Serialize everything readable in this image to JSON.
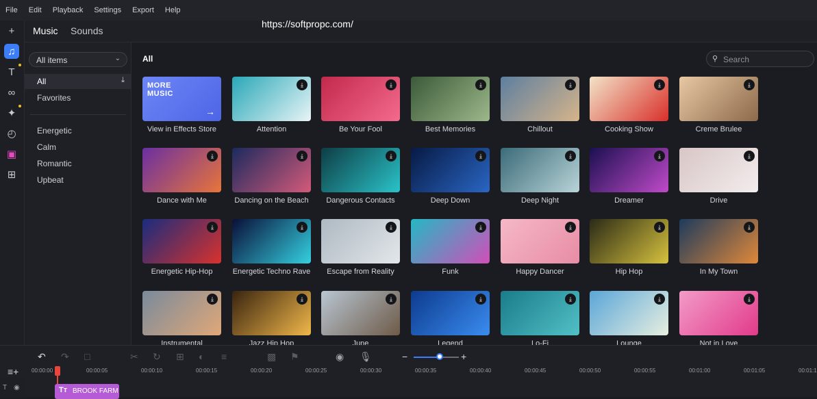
{
  "menu": [
    "File",
    "Edit",
    "Playback",
    "Settings",
    "Export",
    "Help"
  ],
  "watermark": "https://softpropc.com/",
  "tabs": {
    "music": "Music",
    "sounds": "Sounds"
  },
  "rail_icons": [
    "plus-icon",
    "music-note-icon",
    "text-icon",
    "transitions-icon",
    "magic-wand-icon",
    "stickers-icon",
    "shopping-bag-icon",
    "more-tools-icon"
  ],
  "sidebar": {
    "dropdown_value": "All items",
    "items": [
      {
        "label": "All",
        "active": true
      },
      {
        "label": "Favorites",
        "active": false
      },
      {
        "label": "Energetic",
        "active": false
      },
      {
        "label": "Calm",
        "active": false
      },
      {
        "label": "Romantic",
        "active": false
      },
      {
        "label": "Upbeat",
        "active": false
      }
    ]
  },
  "content": {
    "title": "All",
    "search_placeholder": "Search",
    "more_music": {
      "title_line1": "MORE",
      "title_line2": "MUSIC",
      "caption": "View in Effects Store"
    },
    "tracks": [
      {
        "caption": "Attention",
        "colors": [
          "#2aa8b8",
          "#e8f4f6"
        ]
      },
      {
        "caption": "Be Your Fool",
        "colors": [
          "#c2294b",
          "#f36b8e"
        ]
      },
      {
        "caption": "Best Memories",
        "colors": [
          "#3c5a3a",
          "#9db88a"
        ]
      },
      {
        "caption": "Chillout",
        "colors": [
          "#5d7fa0",
          "#d6b48a"
        ]
      },
      {
        "caption": "Cooking Show",
        "colors": [
          "#f2e3c8",
          "#d9302a"
        ]
      },
      {
        "caption": "Creme Brulee",
        "colors": [
          "#e8c8a3",
          "#8c6a4b"
        ]
      },
      {
        "caption": "Dance with Me",
        "colors": [
          "#6a2fa1",
          "#e8753a"
        ]
      },
      {
        "caption": "Dancing on the Beach",
        "colors": [
          "#1c2a5e",
          "#d45a7a"
        ]
      },
      {
        "caption": "Dangerous Contacts",
        "colors": [
          "#0e3d44",
          "#2ac3c9"
        ]
      },
      {
        "caption": "Deep Down",
        "colors": [
          "#071a44",
          "#2a66c4"
        ]
      },
      {
        "caption": "Deep Night",
        "colors": [
          "#3b6b78",
          "#b8d4d8"
        ]
      },
      {
        "caption": "Dreamer",
        "colors": [
          "#1b1050",
          "#c04ac9"
        ]
      },
      {
        "caption": "Drive",
        "colors": [
          "#d8c6c6",
          "#f3eded"
        ]
      },
      {
        "caption": "Energetic Hip-Hop",
        "colors": [
          "#1a2c7e",
          "#d8322c"
        ]
      },
      {
        "caption": "Energetic Techno Rave",
        "colors": [
          "#0a0f38",
          "#34d0e0"
        ]
      },
      {
        "caption": "Escape from Reality",
        "colors": [
          "#aeb9c2",
          "#e3e7ea"
        ]
      },
      {
        "caption": "Funk",
        "colors": [
          "#24b8c4",
          "#d04fb8"
        ]
      },
      {
        "caption": "Happy Dancer",
        "colors": [
          "#f5b8c6",
          "#e88ca6"
        ]
      },
      {
        "caption": "Hip Hop",
        "colors": [
          "#2b2a17",
          "#d6c23e"
        ]
      },
      {
        "caption": "In My Town",
        "colors": [
          "#1d3b5c",
          "#e0883a"
        ]
      },
      {
        "caption": "Instrumental",
        "colors": [
          "#7a8a9c",
          "#e0a878"
        ]
      },
      {
        "caption": "Jazz Hip Hop",
        "colors": [
          "#3a2410",
          "#f0b84a"
        ]
      },
      {
        "caption": "June",
        "colors": [
          "#b8c6d2",
          "#6e5a48"
        ]
      },
      {
        "caption": "Legend",
        "colors": [
          "#0d3b8e",
          "#3a8cf0"
        ]
      },
      {
        "caption": "Lo-Fi",
        "colors": [
          "#1a7c8a",
          "#52c0c6"
        ]
      },
      {
        "caption": "Lounge",
        "colors": [
          "#5aa6d8",
          "#e8efe0"
        ]
      },
      {
        "caption": "Not in Love",
        "colors": [
          "#f29bc8",
          "#e23a8a"
        ]
      }
    ]
  },
  "timeline": {
    "ticks": [
      "00:00:00",
      "00:00:05",
      "00:00:10",
      "00:00:15",
      "00:00:20",
      "00:00:25",
      "00:00:30",
      "00:00:35",
      "00:00:40",
      "00:00:45",
      "00:00:50",
      "00:00:55",
      "00:01:00",
      "00:01:05",
      "00:01:1"
    ],
    "clip_label": "BROOK FARM",
    "zoom_level": 0.58
  }
}
